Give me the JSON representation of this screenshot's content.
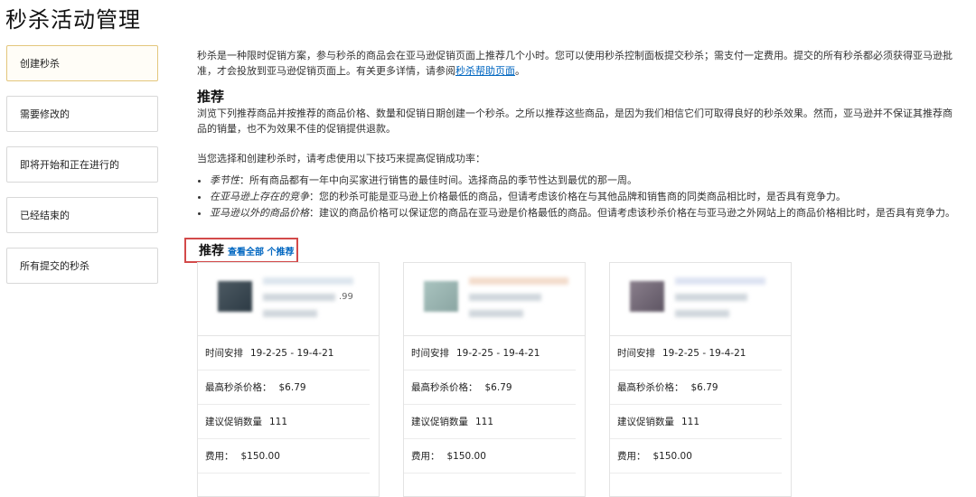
{
  "page_title": "秒杀活动管理",
  "sidebar": {
    "items": [
      {
        "label": "创建秒杀"
      },
      {
        "label": "需要修改的"
      },
      {
        "label": "即将开始和正在进行的"
      },
      {
        "label": "已经结束的"
      },
      {
        "label": "所有提交的秒杀"
      }
    ]
  },
  "intro": {
    "text": "秒杀是一种限时促销方案，参与秒杀的商品会在亚马逊促销页面上推荐几个小时。您可以使用秒杀控制面板提交秒杀；需支付一定费用。提交的所有秒杀都必须获得亚马逊批准，才会投放到亚马逊促销页面上。有关更多详情，请参阅",
    "link": "秒杀帮助页面",
    "end": "。"
  },
  "recommend": {
    "heading": "推荐",
    "description": "浏览下列推荐商品并按推荐的商品价格、数量和促销日期创建一个秒杀。之所以推荐这些商品，是因为我们相信它们可取得良好的秒杀效果。然而，亚马逊并不保证其推荐商品的销量，也不为效果不佳的促销提供退款。"
  },
  "tips": {
    "intro": "当您选择和创建秒杀时，请考虑使用以下技巧来提高促销成功率：",
    "items": [
      {
        "label": "季节性",
        "text": "：所有商品都有一年中向买家进行销售的最佳时间。选择商品的季节性达到最优的那一周。"
      },
      {
        "label": "在亚马逊上存在的竞争",
        "text": "：您的秒杀可能是亚马逊上价格最低的商品，但请考虑该价格在与其他品牌和销售商的同类商品相比时，是否具有竞争力。"
      },
      {
        "label": "亚马逊以外的商品价格",
        "text": "：建议的商品价格可以保证您的商品在亚马逊是价格最低的商品。但请考虑该秒杀价格在与亚马逊之外网站上的商品价格相比时，是否具有竞争力。"
      }
    ]
  },
  "rec_header": {
    "title": "推荐",
    "link": "查看全部 个推荐"
  },
  "cards": [
    {
      "schedule_label": "时间安排",
      "schedule": "19-2-25 - 19-4-21",
      "price_label": "最高秒杀价格：",
      "price": "$6.79",
      "qty_label": "建议促销数量",
      "qty": "111",
      "fee_label": "费用：",
      "fee": "$150.00",
      "partial_text": ".99"
    },
    {
      "schedule_label": "时间安排",
      "schedule": "19-2-25 - 19-4-21",
      "price_label": "最高秒杀价格：",
      "price": "$6.79",
      "qty_label": "建议促销数量",
      "qty": "111",
      "fee_label": "费用：",
      "fee": "$150.00"
    },
    {
      "schedule_label": "时间安排",
      "schedule": "19-2-25 - 19-4-21",
      "price_label": "最高秒杀价格：",
      "price": "$6.79",
      "qty_label": "建议促销数量",
      "qty": "111",
      "fee_label": "费用：",
      "fee": "$150.00"
    }
  ]
}
